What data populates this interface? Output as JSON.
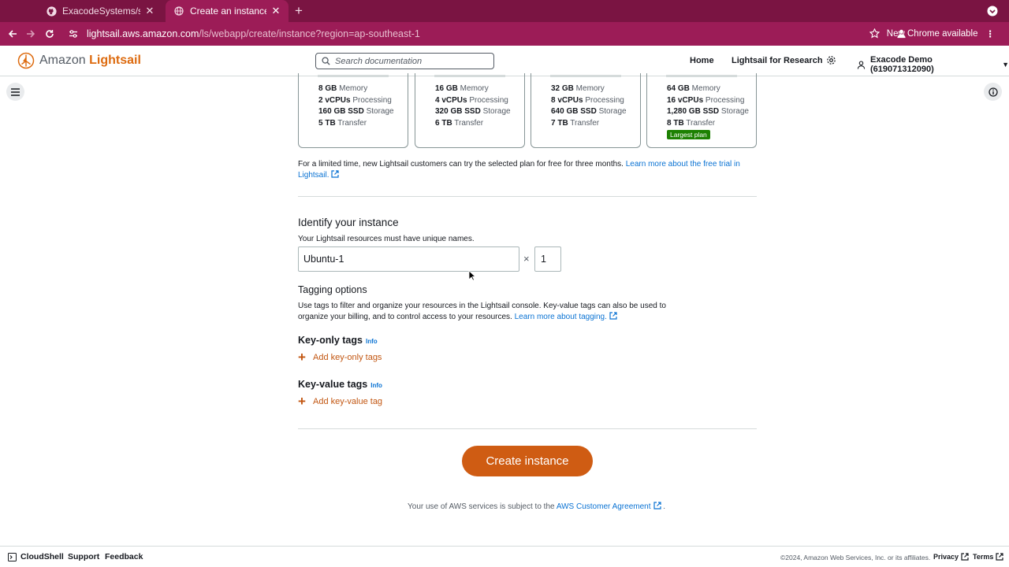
{
  "browser": {
    "tabs": [
      {
        "title": "ExacodeSystems/shipment-r",
        "icon": "github-icon",
        "active": false
      },
      {
        "title": "Create an instance | Lightsail",
        "icon": "globe-icon",
        "active": true
      }
    ],
    "url_domain": "lightsail.aws.amazon.com",
    "url_path": "/ls/webapp/create/instance?region=ap-southeast-1",
    "update_label": "New Chrome available"
  },
  "header": {
    "logo_prefix": "Amazon ",
    "logo_brand": "Lightsail",
    "search_placeholder": "Search documentation",
    "home": "Home",
    "research": "Lightsail for Research",
    "account": "Exacode Demo (619071312090)"
  },
  "plans": [
    {
      "memory_val": "8 GB",
      "memory_lbl": " Memory",
      "vcpu_val": "2 vCPUs",
      "vcpu_lbl": " Processing",
      "ssd_val": "160 GB SSD",
      "ssd_lbl": " Storage",
      "transfer_val": "5 TB",
      "transfer_lbl": " Transfer"
    },
    {
      "memory_val": "16 GB",
      "memory_lbl": " Memory",
      "vcpu_val": "4 vCPUs",
      "vcpu_lbl": " Processing",
      "ssd_val": "320 GB SSD",
      "ssd_lbl": " Storage",
      "transfer_val": "6 TB",
      "transfer_lbl": " Transfer"
    },
    {
      "memory_val": "32 GB",
      "memory_lbl": " Memory",
      "vcpu_val": "8 vCPUs",
      "vcpu_lbl": " Processing",
      "ssd_val": "640 GB SSD",
      "ssd_lbl": " Storage",
      "transfer_val": "7 TB",
      "transfer_lbl": " Transfer"
    },
    {
      "memory_val": "64 GB",
      "memory_lbl": " Memory",
      "vcpu_val": "16 vCPUs",
      "vcpu_lbl": " Processing",
      "ssd_val": "1,280 GB SSD",
      "ssd_lbl": " Storage",
      "transfer_val": "8 TB",
      "transfer_lbl": " Transfer",
      "badge": "Largest plan"
    }
  ],
  "trial": {
    "text": "For a limited time, new Lightsail customers can try the selected plan for free for three months. ",
    "link": "Learn more about the free trial in Lightsail."
  },
  "identify": {
    "title": "Identify your instance",
    "desc": "Your Lightsail resources must have unique names.",
    "name_value": "Ubuntu-1",
    "times": "×",
    "count_value": "1"
  },
  "tagging": {
    "title": "Tagging options",
    "desc": "Use tags to filter and organize your resources in the Lightsail console. Key-value tags can also be used to organize your billing, and to control access to your resources. ",
    "link": "Learn more about tagging.",
    "key_only_title": "Key-only tags",
    "key_only_info": "Info",
    "key_only_add": "Add key-only tags",
    "key_value_title": "Key-value tags",
    "key_value_info": "Info",
    "key_value_add": "Add key-value tag"
  },
  "create_button": "Create instance",
  "agreement": {
    "text": "Your use of AWS services is subject to the ",
    "link": "AWS Customer Agreement",
    "end": "."
  },
  "footer": {
    "cloudshell": "CloudShell",
    "support": "Support",
    "feedback": "Feedback",
    "copyright": "©2024, Amazon Web Services, Inc. or its affiliates.",
    "privacy": "Privacy",
    "terms": "Terms"
  },
  "colors": {
    "chrome_frame": "#9c1c57",
    "brand_orange": "#cf5c13",
    "link_blue": "#0972d3",
    "badge_green": "#1d8102"
  }
}
